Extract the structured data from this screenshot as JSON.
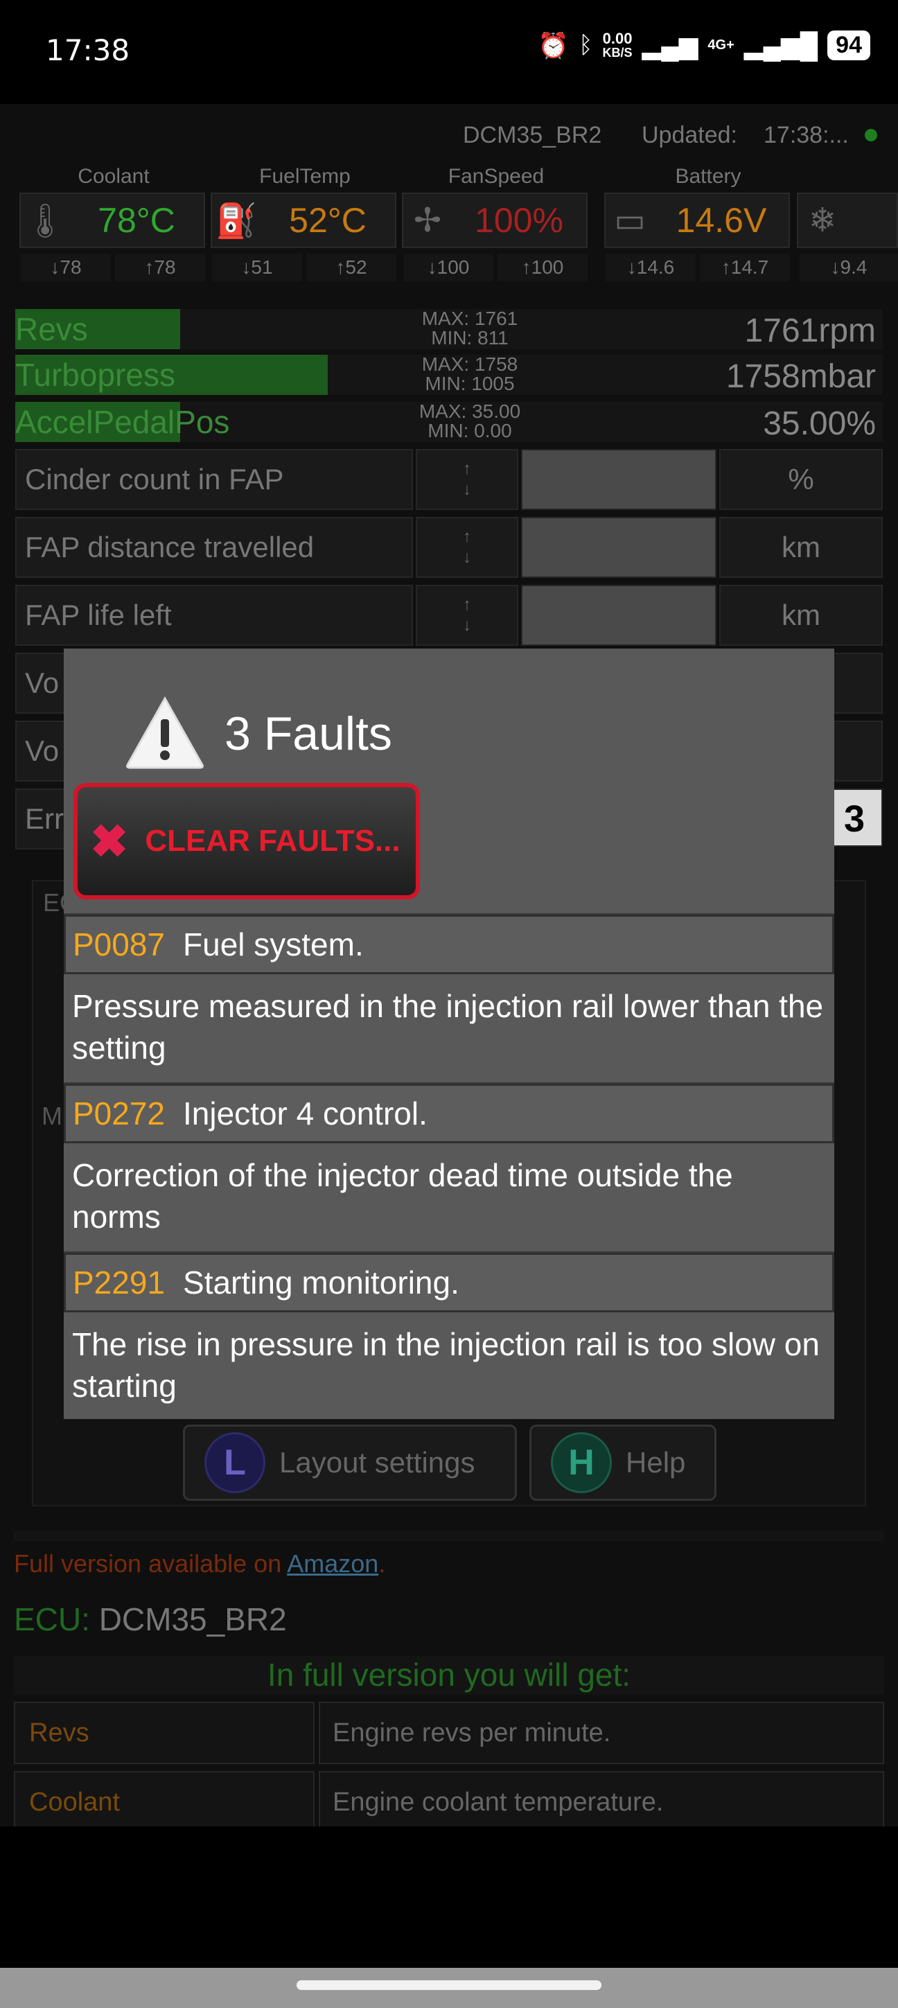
{
  "status_bar": {
    "time": "17:38",
    "net_speed_value": "0.00",
    "net_speed_unit": "KB/S",
    "network_type": "4G+",
    "battery": "94"
  },
  "header": {
    "ecu": "DCM35_BR2",
    "updated_label": "Updated:",
    "updated_value": "17:38:..."
  },
  "gauges": [
    {
      "title": "Coolant",
      "value": "78°C",
      "min": "↓78",
      "max": "↑78",
      "icon": "thermometer-icon",
      "color": "#2fa82f"
    },
    {
      "title": "FuelTemp",
      "value": "52°C",
      "min": "↓51",
      "max": "↑52",
      "icon": "fuel-pump-icon",
      "color": "#c87a10"
    },
    {
      "title": "FanSpeed",
      "value": "100%",
      "min": "↓100",
      "max": "↑100",
      "icon": "fan-icon",
      "color": "#a82020"
    },
    {
      "title": "Battery",
      "value": "14.6V",
      "min": "↓14.6",
      "max": "↑14.7",
      "icon": "battery-icon",
      "color": "#c87a10"
    },
    {
      "title": "",
      "value": "",
      "min": "↓9.4",
      "max": "",
      "icon": "snowflake-icon",
      "color": "#888888"
    }
  ],
  "bars": [
    {
      "name": "Revs",
      "max": "MAX: 1761",
      "min": "MIN: 811",
      "value": "1761rpm",
      "level": 0.19
    },
    {
      "name": "Turbopress",
      "max": "MAX: 1758",
      "min": "MIN: 1005",
      "value": "1758mbar",
      "level": 0.36
    },
    {
      "name": "AccelPedalPos",
      "max": "MAX: 35.00",
      "min": "MIN: 0.00",
      "value": "35.00%",
      "level": 0.19
    }
  ],
  "table": [
    {
      "name": "Cinder count in FAP",
      "unit": "%"
    },
    {
      "name": "FAP distance travelled",
      "unit": "km"
    },
    {
      "name": "FAP life left",
      "unit": "km"
    }
  ],
  "partial_rows": [
    "Vo",
    "Vo",
    "Err",
    "EC",
    "M"
  ],
  "error_count": "3",
  "arrows": {
    "up": "↑",
    "down": "↓"
  },
  "bg_buttons": {
    "layout_letter": "L",
    "layout_label": "Layout settings",
    "help_letter": "H",
    "help_label": "Help"
  },
  "dialog": {
    "title": "3 Faults",
    "clear_label": "CLEAR FAULTS...",
    "faults": [
      {
        "code": "P0087",
        "title": "Fuel system.",
        "desc": "Pressure measured in the injection rail lower than the setting"
      },
      {
        "code": "P0272",
        "title": "Injector 4 control.",
        "desc": "Correction of the injector dead time outside the norms"
      },
      {
        "code": "P2291",
        "title": "Starting monitoring.",
        "desc": "The rise in pressure in the injection rail is too slow on starting"
      }
    ]
  },
  "lower": {
    "full_version_text": "Full version available on ",
    "amazon": "Amazon",
    "full_version_end": ".",
    "ecu_label": "ECU:",
    "ecu_value": "DCM35_BR2",
    "full_get": "In full version you will get:",
    "features": [
      {
        "name": "Revs",
        "desc": "Engine revs per minute."
      },
      {
        "name": "Coolant",
        "desc": "Engine coolant temperature."
      }
    ]
  }
}
